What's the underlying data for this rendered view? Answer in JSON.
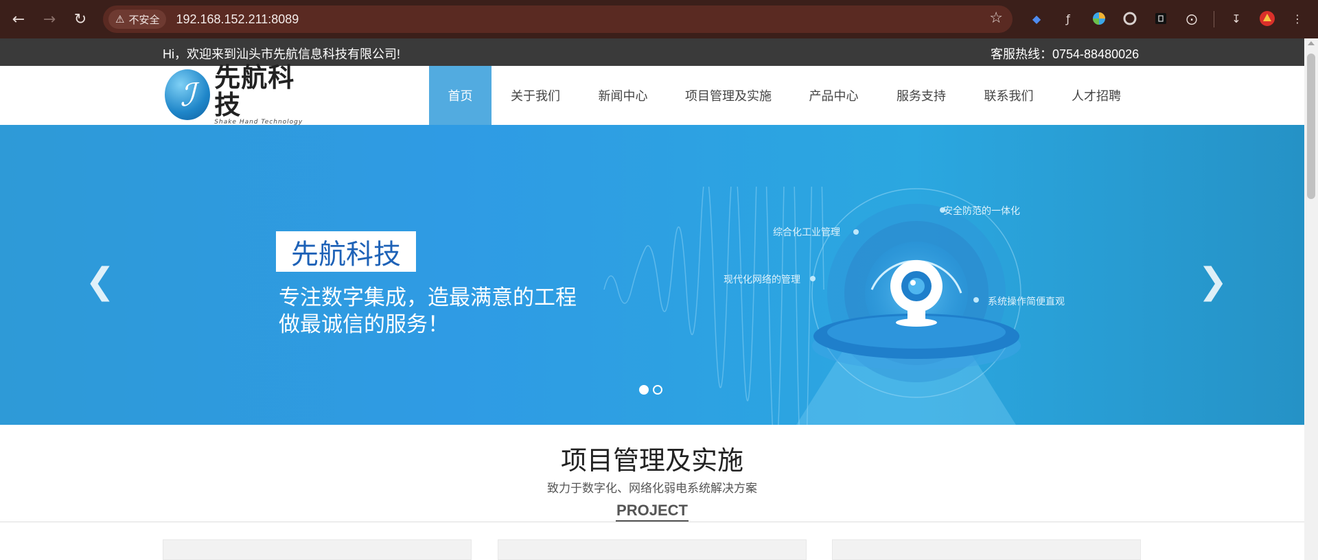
{
  "browser": {
    "security_label": "不安全",
    "url": "192.168.152.211:8089"
  },
  "topbar": {
    "welcome": "Hi，欢迎来到汕头市先航信息科技有限公司!",
    "hotline": "客服热线：0754-88480026"
  },
  "logo": {
    "cn": "先航科技",
    "en": "Shake Hand Technology"
  },
  "nav": {
    "items": [
      {
        "label": "首页"
      },
      {
        "label": "关于我们"
      },
      {
        "label": "新闻中心"
      },
      {
        "label": "项目管理及实施"
      },
      {
        "label": "产品中心"
      },
      {
        "label": "服务支持"
      },
      {
        "label": "联系我们"
      },
      {
        "label": "人才招聘"
      }
    ]
  },
  "banner": {
    "title": "先航科技",
    "slogan_line1": "专注数字集成，造最满意的工程",
    "slogan_line2": "做最诚信的服务！",
    "features": [
      "安全防范的一体化",
      "综合化工业管理",
      "现代化网络的管理",
      "系统操作简便直观"
    ],
    "slide_count": 2,
    "active_slide": 1
  },
  "project_section": {
    "title": "项目管理及实施",
    "subtitle": "致力于数字化、网络化弱电系统解决方案",
    "en_title": "PROJECT"
  },
  "colors": {
    "nav_active": "#52abe0",
    "banner_blue": "#2e9ad7",
    "topbar_bg": "#3a3a3a"
  }
}
